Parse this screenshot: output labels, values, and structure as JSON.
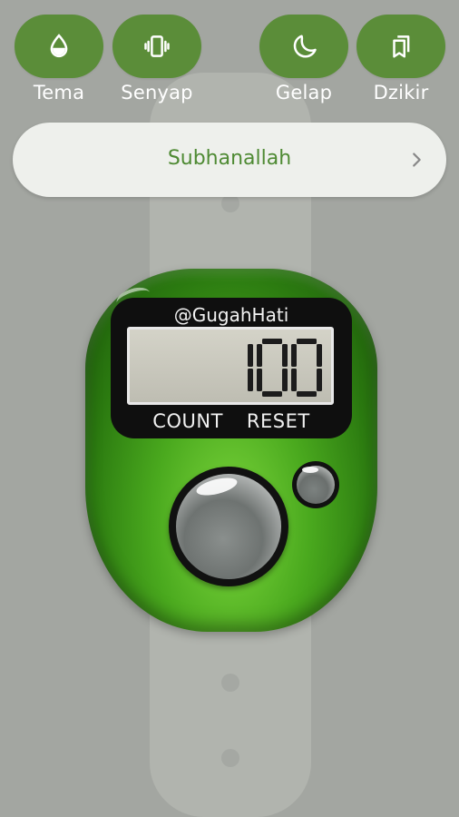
{
  "top_bar": {
    "theme_label": "Tema",
    "silent_label": "Senyap",
    "dark_label": "Gelap",
    "dzikir_label": "Dzikir"
  },
  "selector": {
    "current_dzikir": "Subhanallah"
  },
  "counter": {
    "brand": "@GugahHati",
    "count_value": "100",
    "count_label": "COUNT",
    "reset_label": "RESET"
  },
  "colors": {
    "accent": "#5b8d39",
    "selector_text": "#4e8a33",
    "background": "#a3a6a1",
    "device_green": "#2b7a10"
  },
  "icons": {
    "theme": "water-drop-icon",
    "silent": "vibrate-icon",
    "dark": "moon-icon",
    "dzikir": "bookmarks-icon",
    "selector": "chevron-right-icon"
  }
}
